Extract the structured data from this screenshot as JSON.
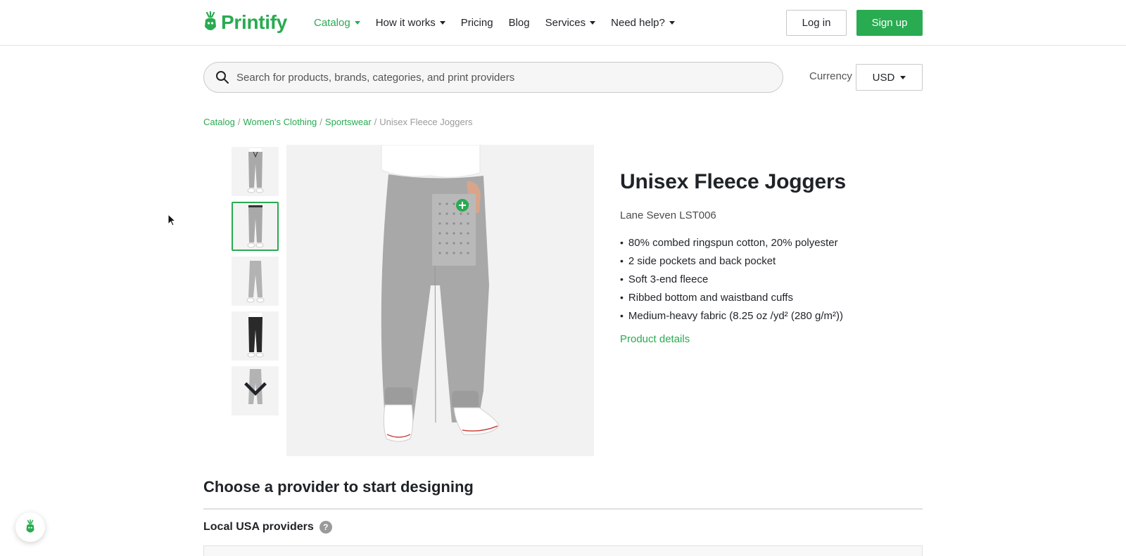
{
  "brand": {
    "name": "Printify",
    "accent": "#29ab51"
  },
  "nav": {
    "items": [
      {
        "label": "Catalog",
        "dropdown": true,
        "active": true
      },
      {
        "label": "How it works",
        "dropdown": true,
        "active": false
      },
      {
        "label": "Pricing",
        "dropdown": false,
        "active": false
      },
      {
        "label": "Blog",
        "dropdown": false,
        "active": false
      },
      {
        "label": "Services",
        "dropdown": true,
        "active": false
      },
      {
        "label": "Need help?",
        "dropdown": true,
        "active": false
      }
    ],
    "login_label": "Log in",
    "signup_label": "Sign up"
  },
  "search": {
    "placeholder": "Search for products, brands, categories, and print providers"
  },
  "currency": {
    "label": "Currency",
    "value": "USD"
  },
  "breadcrumb": {
    "links": [
      "Catalog",
      "Women's Clothing",
      "Sportswear"
    ],
    "separator": "/",
    "current": "Unisex Fleece Joggers"
  },
  "gallery": {
    "thumbnails": [
      {
        "variant": "grey-front",
        "selected": false
      },
      {
        "variant": "grey-back",
        "selected": true
      },
      {
        "variant": "grey-side",
        "selected": false
      },
      {
        "variant": "black-front",
        "selected": false
      },
      {
        "variant": "grey-side-2",
        "selected": false
      }
    ]
  },
  "product": {
    "title": "Unisex Fleece Joggers",
    "subtitle": "Lane Seven LST006",
    "features": [
      "80% combed ringspun cotton, 20% polyester",
      "2 side pockets and back pocket",
      "Soft 3-end fleece",
      "Ribbed bottom and waistband cuffs",
      "Medium-heavy fabric (8.25 oz /yd² (280 g/m²))"
    ],
    "details_link": "Product details"
  },
  "providers": {
    "section_title": "Choose a provider to start designing",
    "local_title": "Local USA providers",
    "help_icon": "?"
  }
}
